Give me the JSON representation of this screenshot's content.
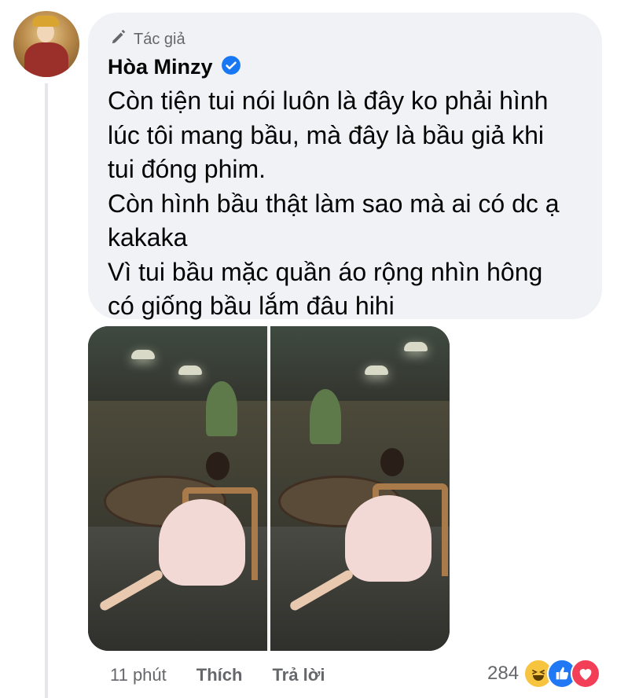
{
  "comment": {
    "author_badge": "Tác giả",
    "author_name": "Hòa Minzy",
    "verified": true,
    "lines": [
      "Còn tiện tui nói luôn là đây ko phải hình",
      "lúc tôi mang bầu, mà đây là bầu giả khi",
      "tui đóng phim.",
      "Còn hình bầu thật làm sao mà ai có dc ạ",
      "kakaka",
      "Vì tui bầu mặc quần áo rộng nhìn hông",
      "có giống bầu lắm đâu hihi"
    ]
  },
  "actions": {
    "time": "11 phút",
    "like_label": "Thích",
    "reply_label": "Trả lời"
  },
  "reactions": {
    "count": "284",
    "icons": [
      "haha-icon",
      "like-icon",
      "love-icon"
    ]
  },
  "colors": {
    "bubble": "#f0f2f5",
    "verified": "#1877f2",
    "meta_text": "#65676b"
  }
}
